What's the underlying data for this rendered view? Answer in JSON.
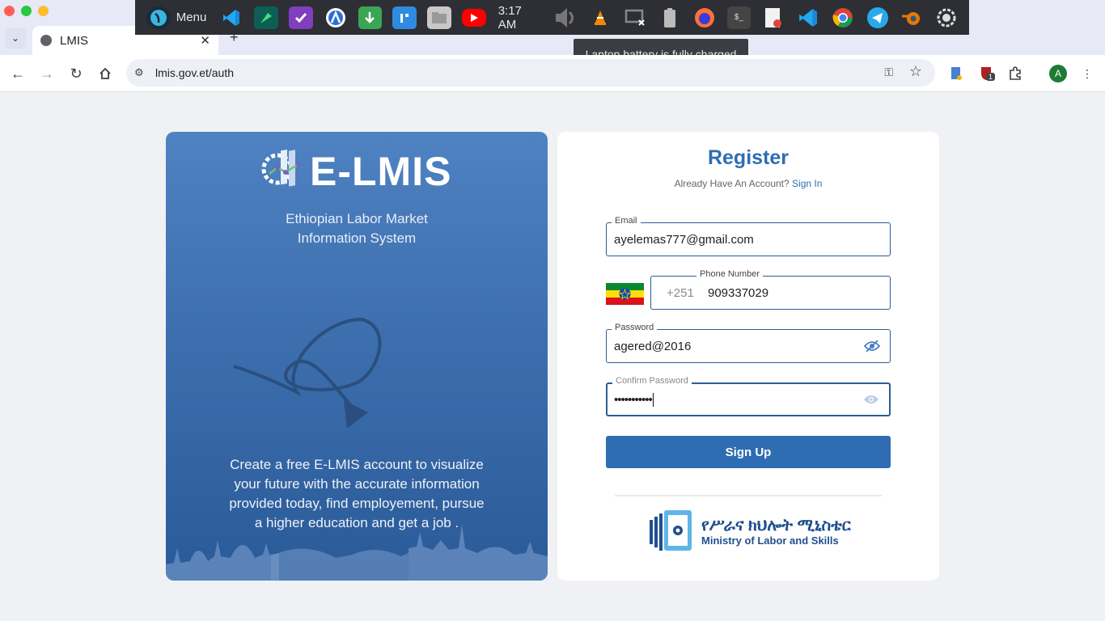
{
  "browser": {
    "tab_title": "LMIS",
    "url": "lmis.gov.et/auth",
    "profile_initial": "A",
    "extension_badge": "1"
  },
  "taskbar": {
    "menu_label": "Menu",
    "clock": "3:17 AM",
    "tooltip": "Laptop battery is fully charged",
    "icons": [
      "mint-menu-icon",
      "vscode-icon",
      "jetbrains-icon",
      "tasks-icon",
      "appimage-icon",
      "update-icon",
      "editor-icon",
      "files-icon",
      "youtube-icon",
      "volume-icon",
      "vlc-icon",
      "display-icon",
      "battery-icon",
      "firefox-icon",
      "terminal-icon",
      "text-editor-icon",
      "vscode-icon",
      "chrome-icon",
      "telegram-icon",
      "blender-icon",
      "settings-icon"
    ]
  },
  "hero": {
    "brand": "E-LMIS",
    "subtitle_line1": "Ethiopian Labor Market",
    "subtitle_line2": "Information System",
    "tagline": "Create a free E-LMIS account to visualize your future with the accurate information provided today, find employement, pursue a higher education and get a job ."
  },
  "form": {
    "title": "Register",
    "account_prompt": "Already Have An Account?",
    "signin_link": "Sign In",
    "email_label": "Email",
    "email_value": "ayelemas777@gmail.com",
    "phone_label": "Phone Number",
    "phone_prefix": "+251",
    "phone_value": "909337029",
    "password_label": "Password",
    "password_value": "agered@2016",
    "confirm_label": "Confirm Password",
    "confirm_value": "•••••••••••",
    "submit_label": "Sign Up"
  },
  "footer": {
    "ministry_amharic": "የሥራና ክህሎት ሚኒስቴር",
    "ministry_english": "Ministry of Labor and Skills"
  },
  "colors": {
    "brand_blue": "#2f6db3",
    "field_border": "#2c5d94",
    "hero_top": "#4f82c2",
    "hero_bottom": "#2a5a98"
  }
}
